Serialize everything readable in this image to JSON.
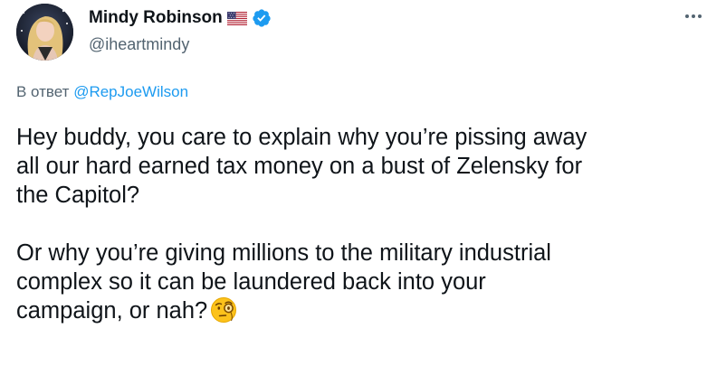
{
  "author": {
    "display_name": "Mindy Robinson",
    "handle": "@iheartmindy",
    "flag_icon": "us-flag-icon",
    "verified_icon": "verified-badge-icon",
    "verified_color": "#1d9bf0"
  },
  "reply_to": {
    "prefix": "В ответ",
    "mention": "@RepJoeWilson",
    "mention_color": "#1d9bf0"
  },
  "more_icon": "more-horizontal-icon",
  "tweet": {
    "line_1": "Hey buddy, you care to explain why you’re pissing away",
    "line_2": "all our hard earned tax money on a bust of Zelensky for",
    "line_3": "the Capitol?",
    "line_4": "Or why you’re giving millions to the military industrial",
    "line_5": "complex so it can be laundered back into your",
    "line_6": "campaign, or nah?",
    "emoji": "face-with-monocle-icon"
  }
}
